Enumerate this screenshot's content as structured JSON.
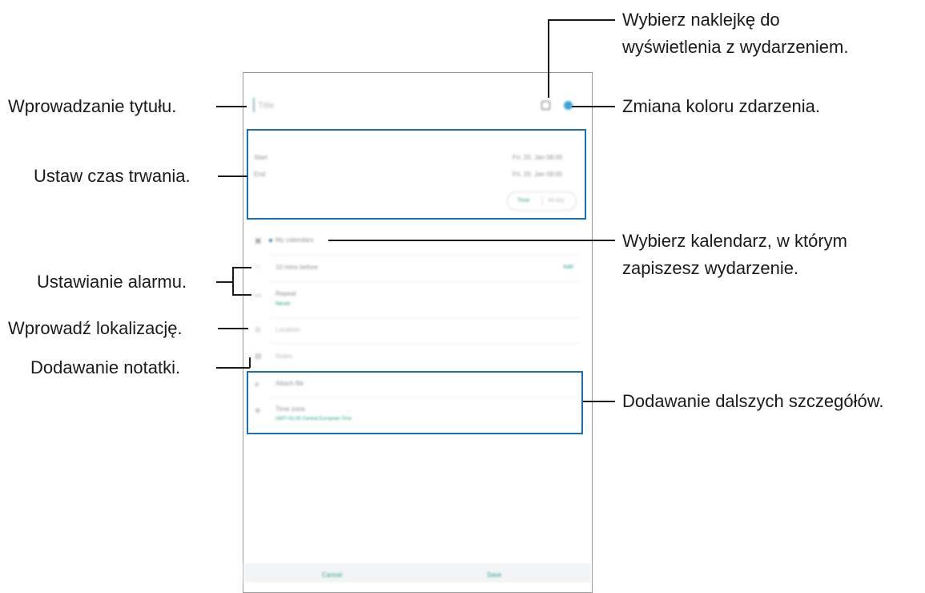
{
  "event_screen": {
    "title_placeholder": "Title",
    "start_label": "Start",
    "start_value": "Fri, 20. Jan  08:00",
    "end_label": "End",
    "end_value": "Fri, 20. Jan  09:00",
    "allday_options": [
      "Time",
      "All day"
    ],
    "calendar_name": "My calendars",
    "alarm_text": "10 mins before",
    "alarm_action": "Add",
    "repeat_label": "Repeat",
    "repeat_value": "Never",
    "location_placeholder": "Location",
    "notes_placeholder": "Notes",
    "attach_label": "Attach file",
    "timezone_label": "Time zone",
    "timezone_value": "GMT+01:00 Central European Time",
    "cancel_label": "Cancel",
    "save_label": "Save",
    "accent_color": "#2aa38f",
    "event_color_dot": "#3aa6d8"
  },
  "callouts": {
    "title": "Wprowadzanie tytułu.",
    "duration": "Ustaw czas trwania.",
    "alarm": "Ustawianie alarmu.",
    "location": "Wprowadź lokalizację.",
    "notes": "Dodawanie notatki.",
    "sticker_line1": "Wybierz naklejkę do",
    "sticker_line2": "wyświetlenia z wydarzeniem.",
    "color": "Zmiana koloru zdarzenia.",
    "calendar_line1": "Wybierz kalendarz, w którym",
    "calendar_line2": "zapiszesz wydarzenie.",
    "more": "Dodawanie dalszych szczegółów."
  },
  "icons": {
    "sticker": "sticker-icon",
    "calendar": "calendar-icon",
    "alarm": "bell-icon",
    "repeat": "repeat-icon",
    "location": "location-pin-icon",
    "notes": "note-icon",
    "attach": "paperclip-icon",
    "timezone": "globe-icon"
  }
}
